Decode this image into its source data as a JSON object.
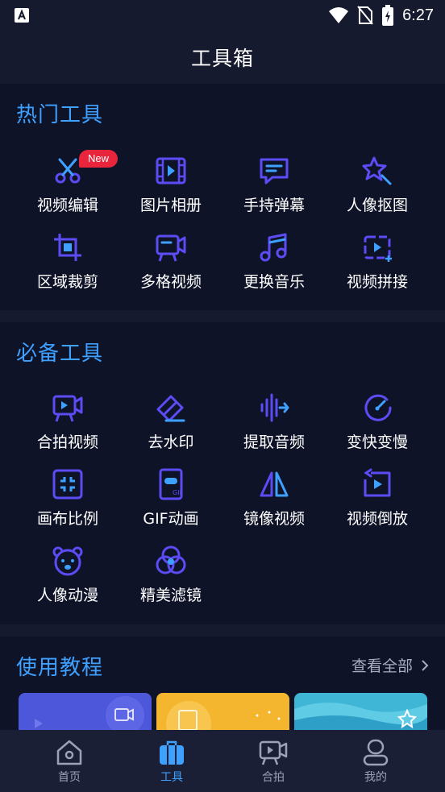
{
  "status_bar": {
    "time": "6:27"
  },
  "header": {
    "title": "工具箱"
  },
  "hot_tools": {
    "title": "热门工具",
    "badge": "New",
    "items": [
      {
        "label": "视频编辑",
        "icon": "scissors-icon"
      },
      {
        "label": "图片相册",
        "icon": "film-strip-icon"
      },
      {
        "label": "手持弹幕",
        "icon": "chat-bubble-icon"
      },
      {
        "label": "人像抠图",
        "icon": "star-wand-icon"
      },
      {
        "label": "区域裁剪",
        "icon": "crop-icon"
      },
      {
        "label": "多格视频",
        "icon": "video-camera-icon"
      },
      {
        "label": "更换音乐",
        "icon": "music-note-icon"
      },
      {
        "label": "视频拼接",
        "icon": "video-merge-icon"
      }
    ]
  },
  "essential_tools": {
    "title": "必备工具",
    "items": [
      {
        "label": "合拍视频",
        "icon": "duet-camera-icon"
      },
      {
        "label": "去水印",
        "icon": "eraser-icon"
      },
      {
        "label": "提取音频",
        "icon": "audio-wave-icon"
      },
      {
        "label": "变快变慢",
        "icon": "speed-gauge-icon"
      },
      {
        "label": "画布比例",
        "icon": "aspect-ratio-icon"
      },
      {
        "label": "GIF动画",
        "icon": "gif-icon"
      },
      {
        "label": "镜像视频",
        "icon": "mirror-icon"
      },
      {
        "label": "视频倒放",
        "icon": "reverse-play-icon"
      },
      {
        "label": "人像动漫",
        "icon": "bear-face-icon"
      },
      {
        "label": "精美滤镜",
        "icon": "filter-circles-icon"
      }
    ]
  },
  "tutorials": {
    "title": "使用教程",
    "more": "查看全部"
  },
  "tabbar": {
    "items": [
      {
        "label": "首页",
        "icon": "home-icon"
      },
      {
        "label": "工具",
        "icon": "toolbox-icon"
      },
      {
        "label": "合拍",
        "icon": "camera-tab-icon"
      },
      {
        "label": "我的",
        "icon": "profile-icon"
      }
    ]
  },
  "colors": {
    "accent": "#3ea0ff",
    "icon_stroke": "#5b4cf5",
    "badge": "#e8253a",
    "background": "#151a2e",
    "panel": "#0f1328"
  }
}
